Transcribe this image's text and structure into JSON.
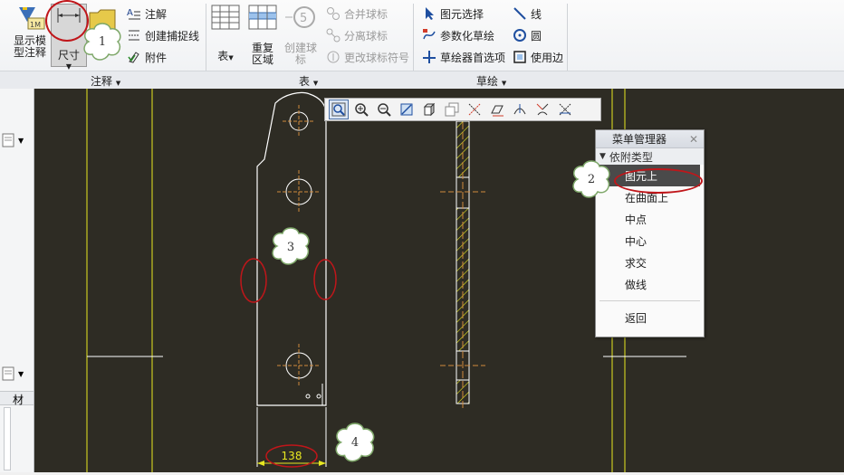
{
  "ribbon": {
    "groups": [
      {
        "label": "注释"
      },
      {
        "label": "表"
      },
      {
        "label": "草绘"
      }
    ],
    "annotation": {
      "show_model_annotations": "显示模型注释",
      "dimension": "尺寸",
      "note": "注解",
      "create_capture_line": "创建捕捉线",
      "attachment": "附件"
    },
    "table": {
      "table": "表",
      "repeat_region": "重复区域",
      "create_balloon": "创建球标",
      "merge_balloons": "合并球标",
      "separate_balloons": "分离球标",
      "change_balloon_symbol": "更改球标符号"
    },
    "sketch": {
      "element_select": "图元选择",
      "parametric_sketch": "参数化草绘",
      "sketcher_prefs": "草绘器首选项",
      "line": "线",
      "circle": "圆",
      "use_edge": "使用边"
    }
  },
  "menu_manager": {
    "title": "菜单管理器",
    "section": "依附类型",
    "items": [
      "图元上",
      "在曲面上",
      "中点",
      "中心",
      "求交",
      "做线"
    ],
    "selected_index": 0,
    "back": "返回"
  },
  "drawing": {
    "dimension_value": "138"
  },
  "left_panel": {
    "column_label": "材"
  },
  "callouts": [
    "1",
    "2",
    "3",
    "4"
  ],
  "colors": {
    "canvas": "#2e2c24",
    "frame": "#e8e820",
    "geometry": "#ffffff",
    "centerline": "#d08a3c",
    "highlight": "#c0161a"
  }
}
